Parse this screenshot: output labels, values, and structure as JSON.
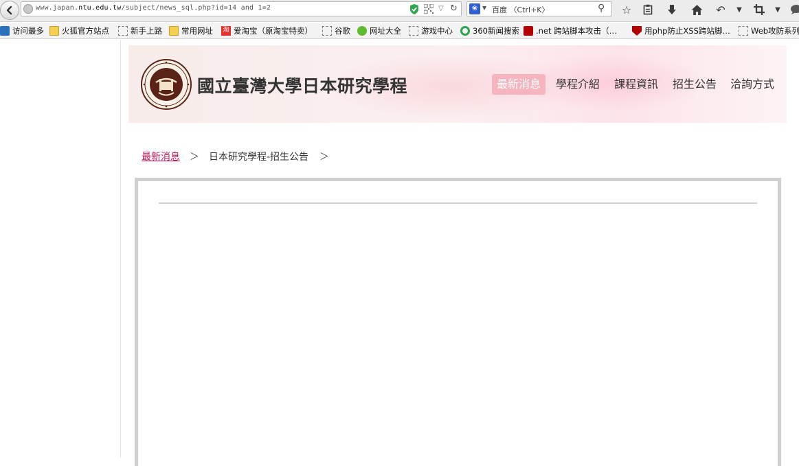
{
  "browser": {
    "url_plain_1": "www.japan.",
    "url_bold": "ntu.edu.tw",
    "url_plain_2": "/subject/news_sql.php?id=14 and 1=2",
    "search_placeholder": "百度 〈Ctrl+K〉"
  },
  "bookmarks": [
    {
      "label": "访问最多",
      "icon": "most-visited-icon"
    },
    {
      "label": "火狐官方站点",
      "icon": "folder-icon"
    },
    {
      "label": "新手上路",
      "icon": "page-icon"
    },
    {
      "label": "常用网址",
      "icon": "folder-icon"
    },
    {
      "label": "爱淘宝（原淘宝特卖）",
      "icon": "taobao-icon"
    },
    {
      "label": "谷歌",
      "icon": "page-icon"
    },
    {
      "label": "网址大全",
      "icon": "hao123-icon"
    },
    {
      "label": "游戏中心",
      "icon": "page-icon"
    },
    {
      "label": "360新闻搜索",
      "icon": "360-icon"
    },
    {
      "label": ".net 跨站脚本攻击（…",
      "icon": "site-icon"
    },
    {
      "label": "用php防止XSS跨站脚…",
      "icon": "shield-icon"
    },
    {
      "label": "Web攻防系列",
      "icon": "page-icon"
    }
  ],
  "site": {
    "title": "國立臺灣大學日本研究學程",
    "nav": [
      {
        "label": "最新消息",
        "active": true
      },
      {
        "label": "學程介紹",
        "active": false
      },
      {
        "label": "課程資訊",
        "active": false
      },
      {
        "label": "招生公告",
        "active": false
      },
      {
        "label": "洽詢方式",
        "active": false
      }
    ]
  },
  "breadcrumb": {
    "link": "最新消息",
    "separator": "＞",
    "current": "日本研究學程-招生公告"
  }
}
